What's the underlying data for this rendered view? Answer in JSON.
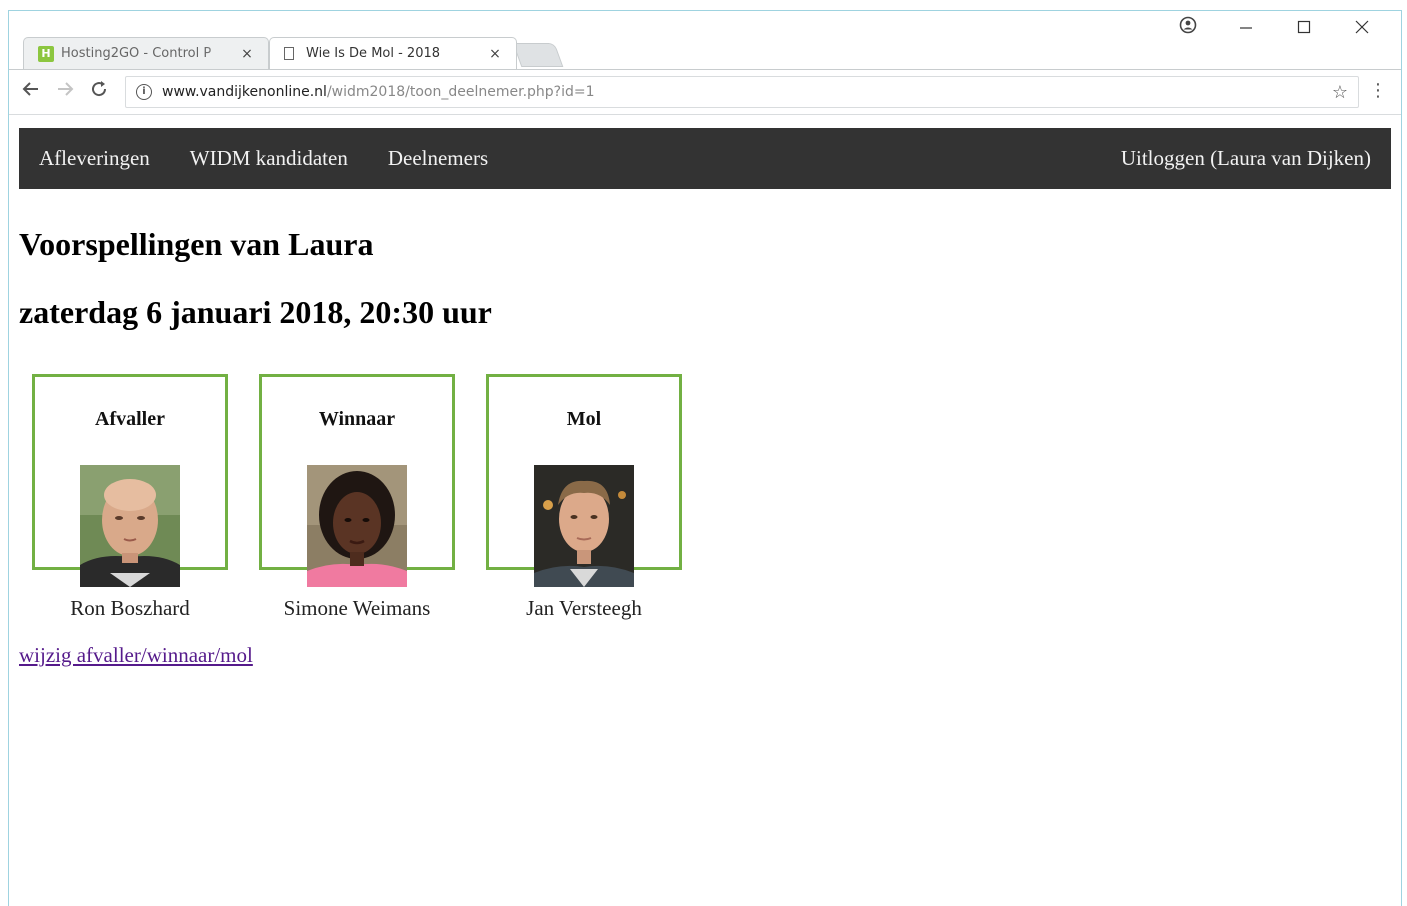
{
  "browser": {
    "tabs": [
      {
        "title": "Hosting2GO - Control P",
        "favicon": "H",
        "active": false
      },
      {
        "title": "Wie Is De Mol - 2018",
        "active": true
      }
    ],
    "close_glyph": "×",
    "url_host": "www.vandijkenonline.nl",
    "url_path": "/widm2018/toon_deelnemer.php?id=1"
  },
  "nav": {
    "items": [
      "Afleveringen",
      "WIDM kandidaten",
      "Deelnemers"
    ],
    "logout": "Uitloggen (Laura van Dijken)"
  },
  "page": {
    "title": "Voorspellingen van Laura",
    "date": "zaterdag 6 januari 2018, 20:30 uur",
    "cards": [
      {
        "role": "Afvaller",
        "name": "Ron Boszhard"
      },
      {
        "role": "Winnaar",
        "name": "Simone Weimans"
      },
      {
        "role": "Mol",
        "name": "Jan Versteegh"
      }
    ],
    "edit_link": "wijzig afvaller/winnaar/mol"
  },
  "colors": {
    "nav_bg": "#333333",
    "card_border": "#72b043",
    "visited_link": "#551a8b"
  }
}
